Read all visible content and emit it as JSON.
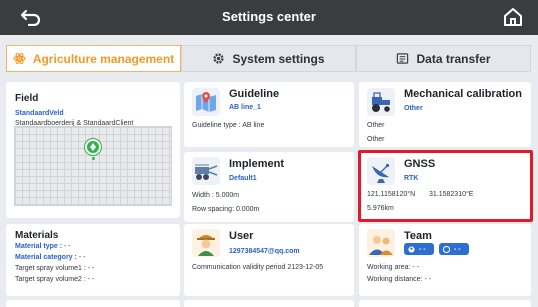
{
  "header": {
    "title": "Settings center",
    "back_icon": "back-arrow-icon",
    "home_icon": "home-icon"
  },
  "tabs": [
    {
      "label": "Agriculture management",
      "icon": "atom-icon",
      "active": true
    },
    {
      "label": "System settings",
      "icon": "gear-icon",
      "active": false
    },
    {
      "label": "Data transfer",
      "icon": "transfer-icon",
      "active": false
    }
  ],
  "field": {
    "title": "Field",
    "name": "StandaardVeld",
    "client": "Standaardboerderij & StandaardClient"
  },
  "materials": {
    "title": "Materials",
    "type_label": "Material type :",
    "type_value": "- -",
    "category_label": "Material category :",
    "category_value": "- -",
    "volume1": "Target spray volume1 : - -",
    "volume2": "Target spray volume2 : - -"
  },
  "guideline": {
    "title": "Guideline",
    "name": "AB line_1",
    "type": "Guideline type : AB line"
  },
  "implement": {
    "title": "Implement",
    "name": "Default1",
    "width": "Width : 5.000m",
    "row_spacing": "Row spacing: 0.000m"
  },
  "user": {
    "title": "User",
    "email": "1297384547@qq.com",
    "validity": "Communication validity period 2123-12-05"
  },
  "mechanical": {
    "title": "Mechanical calibration",
    "sub": "Other",
    "line1": "Other",
    "line2": "Other"
  },
  "gnss": {
    "title": "GNSS",
    "mode": "RTK",
    "lat": "121.1158120°N",
    "lon": "31.1582310°E",
    "distance": "5.976km"
  },
  "team": {
    "title": "Team",
    "chip1": "- -",
    "chip2": "- -",
    "working_area": "Working area:  - -",
    "working_distance": "Working distance:  - -"
  },
  "colors": {
    "accent": "#f39a24",
    "link_blue": "#2a63c4",
    "highlight": "#e3192b",
    "header_bg": "#3a3c40"
  }
}
